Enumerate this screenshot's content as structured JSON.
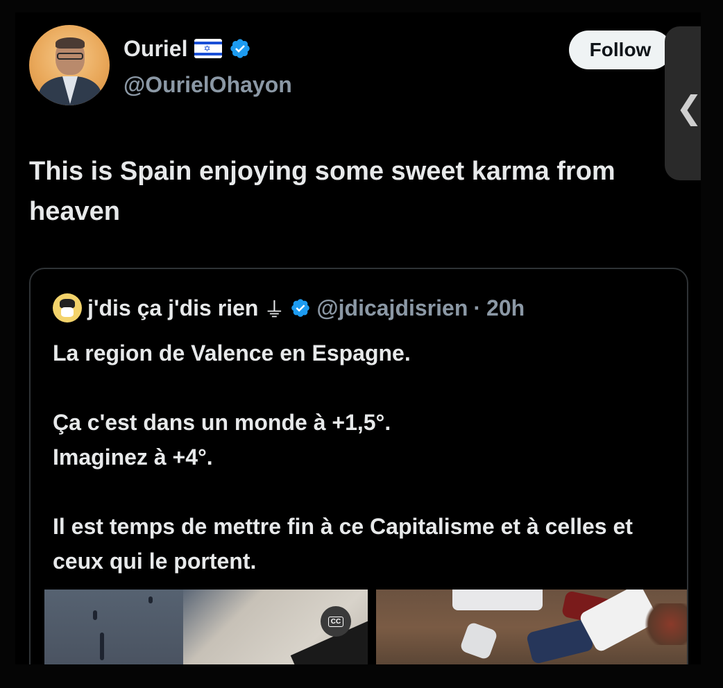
{
  "author": {
    "display_name": "Ouriel",
    "handle": "@OurielOhayon",
    "flag_icon": "israel-flag-icon",
    "verified_icon": "verified-badge-icon"
  },
  "follow_label": "Follow",
  "side_tab_icon": "chevron-left-icon",
  "tweet_text": "This is Spain enjoying some sweet karma from heaven",
  "quote": {
    "display_name": "j'dis ça j'dis rien",
    "symbol": "⏚",
    "handle": "@jdicajdisrien",
    "separator": "·",
    "time": "20h",
    "lines": [
      "La region de Valence en Espagne.",
      "",
      "Ça c'est dans un monde à +1,5°.",
      "Imaginez à +4°.",
      "",
      "Il est temps de mettre fin à ce Capitalisme et à celles et ceux qui le portent."
    ],
    "cc_label": "CC"
  },
  "colors": {
    "background": "#000000",
    "text_primary": "#e7e9ea",
    "text_secondary": "#8b98a5",
    "verified_blue": "#1d9bf0",
    "border": "#2f3336",
    "follow_bg": "#eff3f4"
  }
}
